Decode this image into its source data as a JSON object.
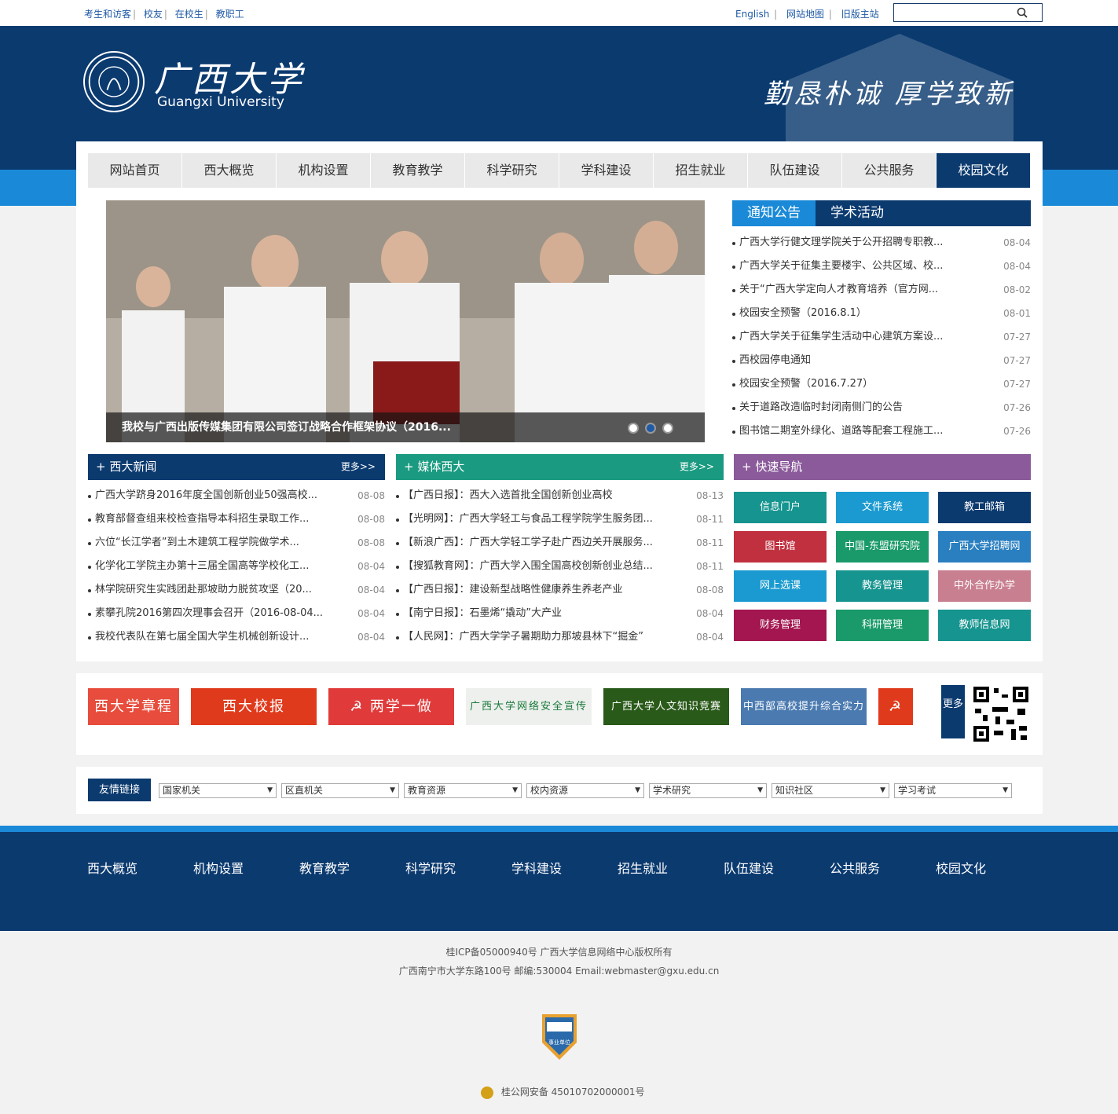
{
  "topbar": {
    "links": [
      "考生和访客",
      "校友",
      "在校生",
      "教职工"
    ],
    "right_links": [
      "English",
      "网站地图",
      "旧版主站"
    ],
    "search_placeholder": ""
  },
  "header": {
    "logo_cn": "广西大学",
    "logo_en": "Guangxi University",
    "motto": "勤恳朴诚 厚学致新"
  },
  "nav": [
    "网站首页",
    "西大概览",
    "机构设置",
    "教育教学",
    "科学研究",
    "学科建设",
    "招生就业",
    "队伍建设",
    "公共服务",
    "校园文化"
  ],
  "slide": {
    "caption": "我校与广西出版传媒集团有限公司签订战略合作框架协议（2016..."
  },
  "notice": {
    "tabs": [
      "通知公告",
      "学术活动"
    ],
    "items": [
      {
        "t": "广西大学行健文理学院关于公开招聘专职教...",
        "d": "08-04"
      },
      {
        "t": "广西大学关于征集主要楼宇、公共区域、校...",
        "d": "08-04"
      },
      {
        "t": "关于“广西大学定向人才教育培养（官方网...",
        "d": "08-02"
      },
      {
        "t": "校园安全预警（2016.8.1）",
        "d": "08-01"
      },
      {
        "t": "广西大学关于征集学生活动中心建筑方案设...",
        "d": "07-27"
      },
      {
        "t": "西校园停电通知",
        "d": "07-27"
      },
      {
        "t": "校园安全预警（2016.7.27）",
        "d": "07-27"
      },
      {
        "t": "关于道路改造临时封闭南侧门的公告",
        "d": "07-26"
      },
      {
        "t": "图书馆二期室外绿化、道路等配套工程施工...",
        "d": "07-26"
      }
    ]
  },
  "news": {
    "title": "+ 西大新闻",
    "more": "更多>>",
    "items": [
      {
        "t": "广西大学跻身2016年度全国创新创业50强高校...",
        "d": "08-08"
      },
      {
        "t": "教育部督查组来校检查指导本科招生录取工作...",
        "d": "08-08"
      },
      {
        "t": "六位“长江学者”到土木建筑工程学院做学术...",
        "d": "08-08"
      },
      {
        "t": "化学化工学院主办第十三届全国高等学校化工...",
        "d": "08-04"
      },
      {
        "t": "林学院研究生实践团赴那坡助力脱贫攻坚（20...",
        "d": "08-04"
      },
      {
        "t": "素攀孔院2016第四次理事会召开（2016-08-04...",
        "d": "08-04"
      },
      {
        "t": "我校代表队在第七届全国大学生机械创新设计...",
        "d": "08-04"
      }
    ]
  },
  "media": {
    "title": "+ 媒体西大",
    "more": "更多>>",
    "items": [
      {
        "t": "【广西日报】：西大入选首批全国创新创业高校",
        "d": "08-13"
      },
      {
        "t": "【光明网】：广西大学轻工与食品工程学院学生服务团...",
        "d": "08-11"
      },
      {
        "t": "【新浪广西】：广西大学轻工学子赴广西边关开展服务...",
        "d": "08-11"
      },
      {
        "t": "【搜狐教育网】：广西大学入围全国高校创新创业总结...",
        "d": "08-11"
      },
      {
        "t": "【广西日报】：建设新型战略性健康养生养老产业",
        "d": "08-08"
      },
      {
        "t": "【南宁日报】：石墨烯“撬动”大产业",
        "d": "08-04"
      },
      {
        "t": "【人民网】：广西大学学子暑期助力那坡县林下“掘金”",
        "d": "08-04"
      }
    ]
  },
  "quick": {
    "title": "+ 快速导航",
    "items": [
      {
        "t": "信息门户",
        "c": "#16948f"
      },
      {
        "t": "文件系统",
        "c": "#1a9ad0"
      },
      {
        "t": "教工邮箱",
        "c": "#0b3a6f"
      },
      {
        "t": "图书馆",
        "c": "#c0303f"
      },
      {
        "t": "中国-东盟研究院",
        "c": "#1a9a6a"
      },
      {
        "t": "广西大学招聘网",
        "c": "#2a7fc0"
      },
      {
        "t": "网上选课",
        "c": "#1a9ad0"
      },
      {
        "t": "教务管理",
        "c": "#16948f"
      },
      {
        "t": "中外合作办学",
        "c": "#c87f8f"
      },
      {
        "t": "财务管理",
        "c": "#a3164f"
      },
      {
        "t": "科研管理",
        "c": "#1a9a6a"
      },
      {
        "t": "教师信息网",
        "c": "#16948f"
      }
    ]
  },
  "banners": [
    {
      "t": "西大学章程",
      "bg": "#e74c3c"
    },
    {
      "t": "西大校报",
      "bg": "#e03a1c"
    },
    {
      "t": "☭ 两学一做",
      "bg": "#e03a3a"
    },
    {
      "t": "广西大学网络安全宣传周",
      "bg": "#eef0ee"
    },
    {
      "t": "广西大学人文知识竞赛",
      "bg": "#2a5a1a"
    },
    {
      "t": "中西部高校提升综合实力计划",
      "bg": "#4a7ab0"
    },
    {
      "t": "☭",
      "bg": "#e03a1c"
    }
  ],
  "banner_more": "更多",
  "links": {
    "label": "友情链接",
    "selects": [
      "国家机关",
      "区直机关",
      "教育资源",
      "校内资源",
      "学术研究",
      "知识社区",
      "学习考试"
    ]
  },
  "footer_nav": [
    "西大概览",
    "机构设置",
    "教育教学",
    "科学研究",
    "学科建设",
    "招生就业",
    "队伍建设",
    "公共服务",
    "校园文化"
  ],
  "copyright": {
    "line1": "桂ICP备05000940号 广西大学信息网络中心版权所有",
    "line2": "广西南宁市大学东路100号 邮编:530004 Email:webmaster@gxu.edu.cn",
    "badge": "事业单位",
    "police": "桂公网安备 45010702000001号"
  },
  "colors": {
    "navy": "#0b3a6f",
    "blue": "#1a8ad8",
    "green": "#1a9a80",
    "purple": "#8a5a9a"
  }
}
